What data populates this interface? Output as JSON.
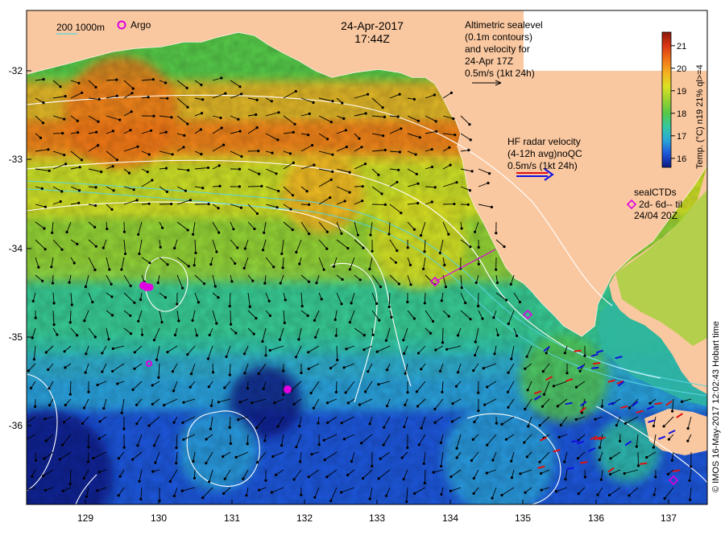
{
  "map": {
    "title_date": "24-Apr-2017",
    "title_time": "17:44Z",
    "depth_legend": "200  1000m",
    "argo_label": "Argo",
    "altimetry_lines": [
      "Altimetric sealevel",
      "(0.1m contours)",
      "and velocity for",
      "24-Apr 17Z",
      "0.5m/s (1kt 24h)"
    ],
    "hf_radar_lines": [
      "HF radar velocity",
      "(4-12h avg)noQC",
      "0.5m/s (1kt 24h)"
    ],
    "seal_lines": [
      "sealCTDs",
      "2d- 6d-- til",
      "24/04 20Z"
    ],
    "credit": "© IMOS 16-May-2017 12:02:43 Hobart time",
    "lat_labels": [
      "-32",
      "-33",
      "-34",
      "-35",
      "-36"
    ],
    "lon_labels": [
      "129",
      "130",
      "131",
      "132",
      "133",
      "134",
      "135",
      "136",
      "137"
    ],
    "colorbar": {
      "title": "Temp. (°C) n19 21% ql>=4",
      "ticks": [
        "21",
        "20",
        "19",
        "18",
        "17",
        "16"
      ],
      "min": 15.6,
      "max": 21.6,
      "colors": [
        "#0a1880",
        "#1f55d8",
        "#2aa6d8",
        "#33c8a0",
        "#55c848",
        "#9cd230",
        "#dde022",
        "#f4b020",
        "#f07418",
        "#d93414",
        "#8a1808"
      ]
    },
    "colors": {
      "land": "#fac8a0",
      "contour": "#ffffff",
      "isobath": "#58d4e0",
      "argo": "#e000e0",
      "seal": "#e000e0",
      "arrow": "#000000",
      "hf_red": "#e01010",
      "hf_blue": "#1010e0"
    }
  }
}
